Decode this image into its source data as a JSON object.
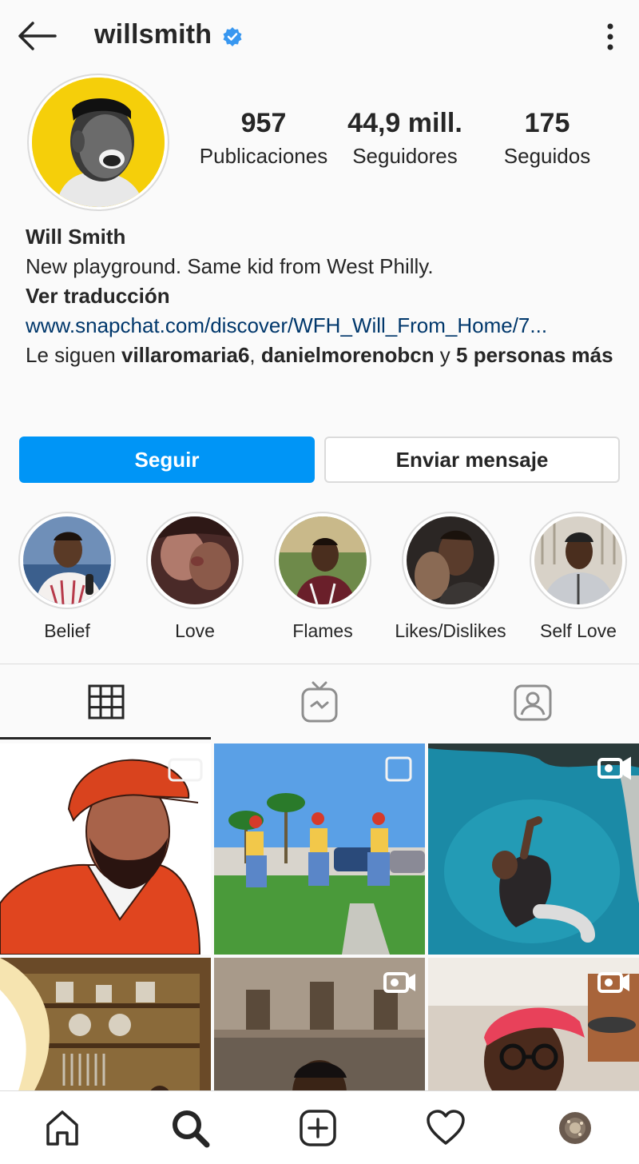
{
  "header": {
    "username": "willsmith",
    "verified": true
  },
  "profile": {
    "stats": {
      "posts_value": "957",
      "posts_label": "Publicaciones",
      "followers_value": "44,9 mill.",
      "followers_label": "Seguidores",
      "following_value": "175",
      "following_label": "Seguidos"
    },
    "name": "Will Smith",
    "bio": "New playground. Same kid from West Philly.",
    "translate": "Ver traducción",
    "link": "www.snapchat.com/discover/WFH_Will_From_Home/7...",
    "followed_by_prefix": "Le siguen ",
    "followed_by_user1": "villaromaria6",
    "followed_by_sep": ", ",
    "followed_by_user2": "danielmorenobcn",
    "followed_by_and": " y ",
    "followed_by_more": "5 personas más"
  },
  "actions": {
    "follow_label": "Seguir",
    "message_label": "Enviar mensaje"
  },
  "highlights": [
    {
      "label": "Belief"
    },
    {
      "label": "Love"
    },
    {
      "label": "Flames"
    },
    {
      "label": "Likes/Dislikes"
    },
    {
      "label": "Self Love"
    }
  ],
  "tabs": [
    {
      "icon": "grid-icon",
      "active": true
    },
    {
      "icon": "igtv-icon",
      "active": false
    },
    {
      "icon": "tagged-icon",
      "active": false
    }
  ],
  "bottom_nav": [
    "home-icon",
    "search-icon",
    "add-post-icon",
    "heart-icon",
    "profile-avatar"
  ],
  "colors": {
    "accent": "#0095f6",
    "link": "#00376b",
    "verified": "#3897f0",
    "avatar_bg": "#f5cf0a"
  }
}
